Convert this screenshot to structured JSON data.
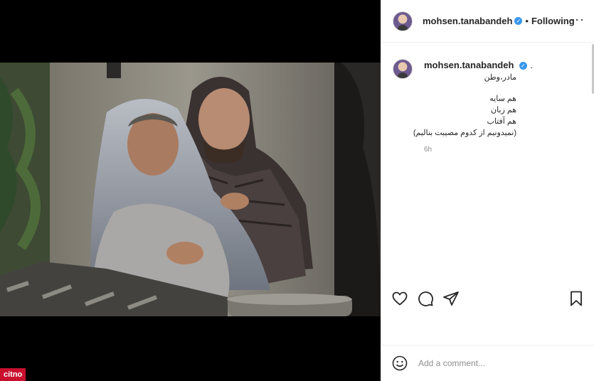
{
  "post": {
    "username": "mohsen.tanabandeh",
    "verified_icon": "verified-badge-icon",
    "separator": "•",
    "follow_status": "Following",
    "more_icon": "more-options-icon"
  },
  "caption": {
    "username": "mohsen.tanabandeh",
    "trailing": ".",
    "lines": [
      "مادر،وطن",
      "",
      "هم سایه",
      "هم زبان",
      "هم آفتاب",
      "(نمیدونیم از کدوم مصیبت بنالیم)"
    ],
    "time": "6h"
  },
  "actions": {
    "like_icon": "heart-icon",
    "comment_icon": "comment-icon",
    "share_icon": "share-icon",
    "save_icon": "bookmark-icon"
  },
  "comment": {
    "emoji_icon": "emoji-icon",
    "placeholder": "Add a comment..."
  },
  "watermark": "citno",
  "colors": {
    "verified": "#3897f0",
    "watermark": "#c8102e",
    "text": "#262626",
    "muted": "#8e8e8e"
  }
}
